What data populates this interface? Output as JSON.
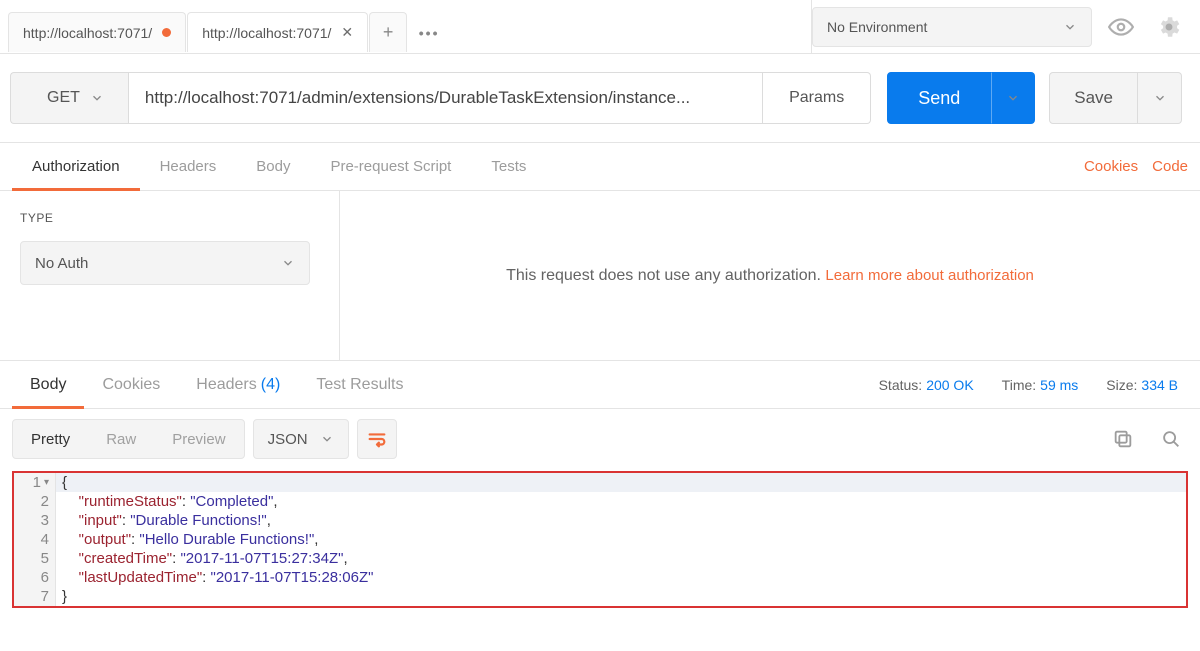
{
  "topbar": {
    "tabs": [
      {
        "label": "http://localhost:7071/",
        "active": false,
        "dirty": true
      },
      {
        "label": "http://localhost:7071/",
        "active": true,
        "dirty": false
      }
    ],
    "environment_selected": "No Environment"
  },
  "request": {
    "method": "GET",
    "url": "http://localhost:7071/admin/extensions/DurableTaskExtension/instance...",
    "params_btn": "Params",
    "send_btn": "Send",
    "save_btn": "Save",
    "subtabs": {
      "auth": "Authorization",
      "headers": "Headers",
      "body": "Body",
      "prerequest": "Pre-request Script",
      "tests": "Tests"
    },
    "links": {
      "cookies": "Cookies",
      "code": "Code"
    }
  },
  "auth": {
    "type_label": "TYPE",
    "selected": "No Auth",
    "message": "This request does not use any authorization. ",
    "learn_link": "Learn more about authorization"
  },
  "response": {
    "tabs": {
      "body": "Body",
      "cookies": "Cookies",
      "headers": "Headers",
      "headers_count": "(4)",
      "testresults": "Test Results"
    },
    "meta": {
      "status_label": "Status:",
      "status_value": "200 OK",
      "time_label": "Time:",
      "time_value": "59 ms",
      "size_label": "Size:",
      "size_value": "334 B"
    },
    "controls": {
      "pretty": "Pretty",
      "raw": "Raw",
      "preview": "Preview",
      "format": "JSON"
    },
    "body_lines": [
      {
        "n": "1",
        "indent": "",
        "key": "",
        "val": "",
        "open": "{",
        "close": ""
      },
      {
        "n": "2",
        "indent": "    ",
        "key": "\"runtimeStatus\"",
        "val": "\"Completed\"",
        "comma": ","
      },
      {
        "n": "3",
        "indent": "    ",
        "key": "\"input\"",
        "val": "\"Durable Functions!\"",
        "comma": ","
      },
      {
        "n": "4",
        "indent": "    ",
        "key": "\"output\"",
        "val": "\"Hello Durable Functions!\"",
        "comma": ","
      },
      {
        "n": "5",
        "indent": "    ",
        "key": "\"createdTime\"",
        "val": "\"2017-11-07T15:27:34Z\"",
        "comma": ","
      },
      {
        "n": "6",
        "indent": "    ",
        "key": "\"lastUpdatedTime\"",
        "val": "\"2017-11-07T15:28:06Z\"",
        "comma": ""
      },
      {
        "n": "7",
        "indent": "",
        "key": "",
        "val": "",
        "open": "",
        "close": "}"
      }
    ]
  }
}
